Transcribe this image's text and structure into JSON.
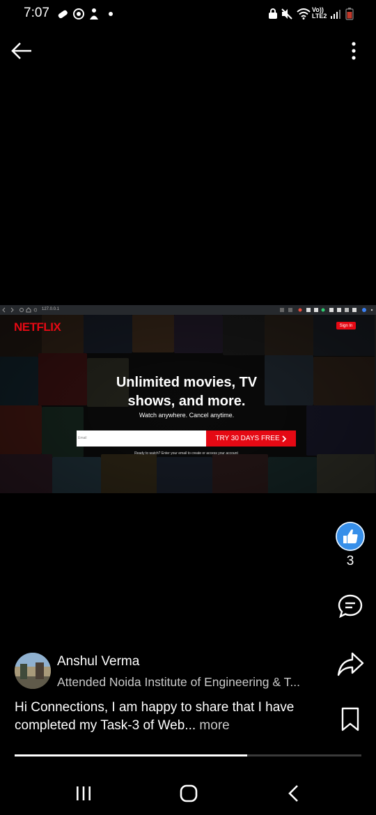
{
  "status_bar": {
    "time": "7:07",
    "network": "Vo)) LTE2"
  },
  "top_bar": {
    "back_icon": "arrow-left-icon",
    "more_icon": "more-vertical-icon"
  },
  "media": {
    "browser_url": "127.0.0.1",
    "netflix": {
      "logo": "NETFLIX",
      "sign_in": "Sign In",
      "title": "Unlimited movies, TV shows, and more.",
      "subtitle": "Watch anywhere. Cancel anytime.",
      "email_placeholder": "Email",
      "cta": "TRY 30 DAYS FREE",
      "cta_icon": "chevron-right-icon",
      "ready_text": "Ready to watch? Enter your email to create or access your account"
    }
  },
  "actions": {
    "like_icon": "thumbs-up-icon",
    "like_count": "3",
    "comment_icon": "comment-icon",
    "share_icon": "share-icon",
    "save_icon": "bookmark-icon"
  },
  "post": {
    "author_name": "Anshul Verma",
    "author_headline": "Attended Noida Institute of Engineering & T...",
    "text": "Hi Connections, I am happy to share that I have completed my Task-3 of Web...",
    "more_label": " more",
    "progress": 0.67
  },
  "nav_bar": {
    "recents_icon": "recents-icon",
    "home_icon": "home-icon",
    "back_icon": "back-chevron-icon"
  },
  "colors": {
    "background": "#000000",
    "netflix_red": "#e50914",
    "like_blue": "#378fe9"
  }
}
